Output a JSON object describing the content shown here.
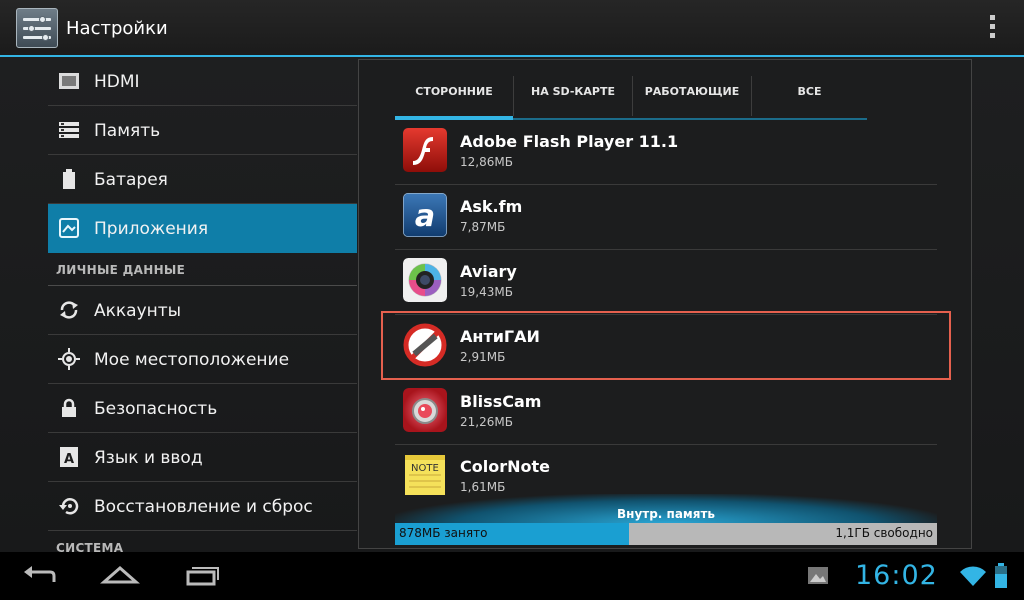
{
  "actionbar": {
    "title": "Настройки"
  },
  "settings": {
    "items": [
      {
        "label": "HDMI",
        "icon": "hdmi-icon"
      },
      {
        "label": "Память",
        "icon": "storage-icon"
      },
      {
        "label": "Батарея",
        "icon": "battery-icon"
      },
      {
        "label": "Приложения",
        "icon": "apps-icon",
        "active": true
      }
    ],
    "header_personal": "ЛИЧНЫЕ ДАННЫЕ",
    "personal_items": [
      {
        "label": "Аккаунты",
        "icon": "sync-icon"
      },
      {
        "label": "Мое местоположение",
        "icon": "location-icon"
      },
      {
        "label": "Безопасность",
        "icon": "lock-icon"
      },
      {
        "label": "Язык и ввод",
        "icon": "language-icon"
      },
      {
        "label": "Восстановление и сброс",
        "icon": "restore-icon"
      }
    ],
    "header_system": "СИСТЕМА"
  },
  "tabs": [
    {
      "label": "СТОРОННИЕ",
      "active": true
    },
    {
      "label": "НА SD-КАРТЕ"
    },
    {
      "label": "РАБОТАЮЩИЕ"
    },
    {
      "label": "ВСЕ"
    }
  ],
  "apps": [
    {
      "name": "Adobe Flash Player 11.1",
      "size": "12,86МБ",
      "icon": "flash-icon"
    },
    {
      "name": "Ask.fm",
      "size": "7,87МБ",
      "icon": "askfm-icon"
    },
    {
      "name": "Aviary",
      "size": "19,43МБ",
      "icon": "aviary-icon"
    },
    {
      "name": "АнтиГАИ",
      "size": "2,91МБ",
      "icon": "antigai-icon"
    },
    {
      "name": "BlissCam",
      "size": "21,26МБ",
      "icon": "blisscam-icon"
    },
    {
      "name": "ColorNote",
      "size": "1,61МБ",
      "icon": "colornote-icon"
    }
  ],
  "colornote_icon_text": "NOTE",
  "storage": {
    "label": "Внутр. память",
    "used": "878МБ занято",
    "free": "1,1ГБ свободно",
    "used_fraction": 0.432
  },
  "status": {
    "clock": "16:02"
  },
  "colors": {
    "accent": "#33b5e5",
    "active_item": "#0f7ea8",
    "highlight": "#e5604e"
  }
}
